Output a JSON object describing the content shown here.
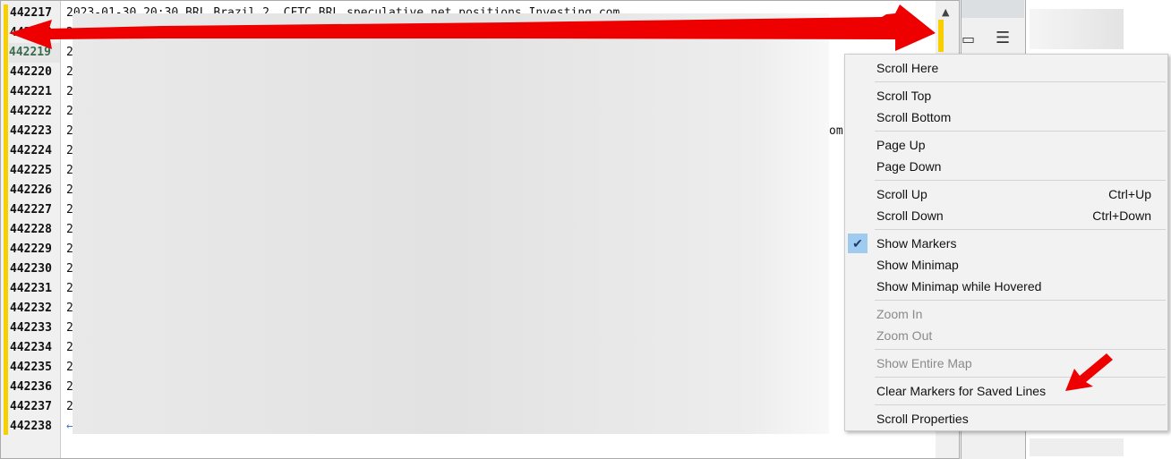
{
  "editor": {
    "line_numbers": [
      "442217",
      "442218",
      "442219",
      "442220",
      "442221",
      "442222",
      "442223",
      "442224",
      "442225",
      "442226",
      "442227",
      "442228",
      "442229",
      "442230",
      "442231",
      "442232",
      "442233",
      "442234",
      "442235",
      "442236",
      "442237",
      "442238"
    ],
    "current_line": "442219",
    "first_line_text": "2023-01-30 20:30 BRL Brazil 2. CFTC BRL speculative net positions Investing.com",
    "line_prefix": "2",
    "fragment_om": "om",
    "marker_color": "#f8d000"
  },
  "context_menu": {
    "items": [
      {
        "label": "Scroll Here"
      },
      {
        "label": "Scroll Top"
      },
      {
        "label": "Scroll Bottom"
      },
      {
        "label": "Page Up"
      },
      {
        "label": "Page Down"
      },
      {
        "label": "Scroll Up",
        "shortcut": "Ctrl+Up"
      },
      {
        "label": "Scroll Down",
        "shortcut": "Ctrl+Down"
      },
      {
        "label": "Show Markers",
        "checked": true
      },
      {
        "label": "Show Minimap"
      },
      {
        "label": "Show Minimap while Hovered"
      },
      {
        "label": "Zoom In",
        "disabled": true
      },
      {
        "label": "Zoom Out",
        "disabled": true
      },
      {
        "label": "Show Entire Map",
        "disabled": true
      },
      {
        "label": "Clear Markers for Saved Lines"
      },
      {
        "label": "Scroll Properties"
      }
    ]
  },
  "annotation_color": "#ee0000"
}
